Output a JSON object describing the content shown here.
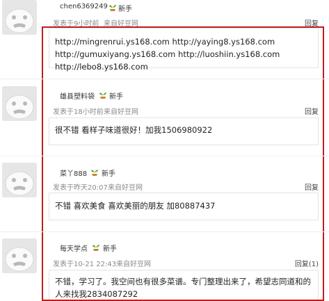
{
  "comments": [
    {
      "username": "chen6369249",
      "rank": "新手",
      "posted": "发表于9小时前",
      "source": "来自好豆网",
      "reply": "回复",
      "content": "http://mingrenrui.ys168.com http://yaying8.ys168.com http://gumuxiyang.ys168.com http://luoshiin.ys168.com http://lebo8.ys168.com"
    },
    {
      "username": "雄县塑料袋",
      "rank": "新手",
      "posted": "发表于18小时前",
      "source": "来自好豆网",
      "reply": "回复",
      "content": "很不错 看样子味道很好！加我1506980922"
    },
    {
      "username": "菜丫888",
      "rank": "新手",
      "posted": "发表于昨天20:07",
      "source": "来自好豆网",
      "reply": "回复",
      "content": "不错 喜欢美食 喜欢美丽的朋友 加80887437"
    },
    {
      "username": "每天学点",
      "rank": "新手",
      "posted": "发表于10-21 22:43",
      "source": "来自好豆网",
      "reply": "回复(1)",
      "content": "不错，学习了。我空间也有很多菜谱。专门整理出来了，希望志同道和的人来找我2834087292"
    }
  ],
  "colors": {
    "highlight_border": "#c21b1b",
    "sprout_leaf": "#6aa630",
    "sprout_pot": "#c8872c"
  }
}
